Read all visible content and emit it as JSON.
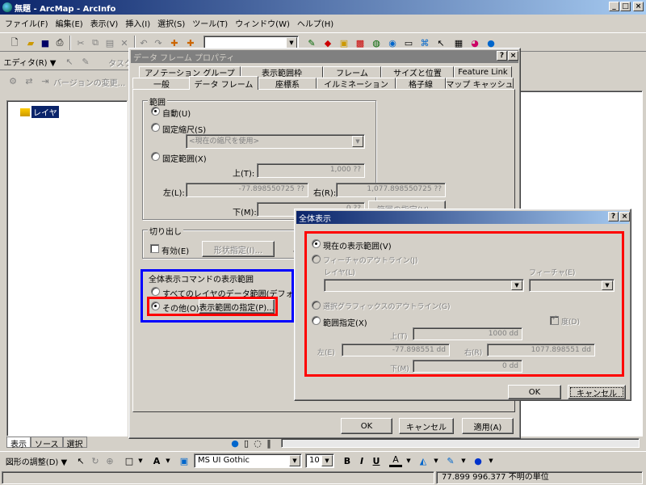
{
  "app": {
    "title": "無題 - ArcMap - ArcInfo"
  },
  "menu": [
    "ファイル(F)",
    "編集(E)",
    "表示(V)",
    "挿入(I)",
    "選択(S)",
    "ツール(T)",
    "ウィンドウ(W)",
    "ヘルプ(H)"
  ],
  "editor": {
    "label": "エディタ(R) ▼",
    "task_hint": "タスク",
    "version_label": "バージョンの変更..."
  },
  "toc": {
    "layer_label": "レイヤ",
    "tabs": [
      "表示",
      "ソース",
      "選択"
    ]
  },
  "draw": {
    "label": "図形の調整(D) ▼",
    "font": "MS UI Gothic",
    "size": "10",
    "bold": "B",
    "italic": "I",
    "underline": "U"
  },
  "status": {
    "coords": "77.899  996.377 不明の単位"
  },
  "props": {
    "title": "データ フレーム プロパティ",
    "tabs_back": [
      "アノテーション グループ",
      "表示範囲枠",
      "フレーム",
      "サイズと位置",
      "Feature Link"
    ],
    "tabs_front": [
      "一般",
      "データ フレーム",
      "座標系",
      "イルミネーション",
      "格子線",
      "マップ キャッシュ"
    ],
    "extent": {
      "group": "範囲",
      "auto": "自動(U)",
      "fixed_scale": "固定縮尺(S)",
      "scale_placeholder": "<現在の縮尺を使用>",
      "fixed_extent": "固定範囲(X)",
      "top_label": "上(T):",
      "top_value": "1,000 ??",
      "left_label": "左(L):",
      "left_value": "-77.898550725 ??",
      "right_label": "右(R):",
      "right_value": "1,077.898550725 ??",
      "bottom_label": "下(M):",
      "bottom_value": "0 ??",
      "specify_btn": "範囲の指定(V)..."
    },
    "clip": {
      "group": "切り出し",
      "enable": "有効(E)",
      "shape_btn": "形状指定(I)...",
      "extra": "ゃ"
    },
    "fullext": {
      "group": "全体表示コマンドの表示範囲",
      "all_layers": "すべてのレイヤのデータ範囲(デフォルト)(D)",
      "other": "その他(O):",
      "specify_btn": "表示範囲の指定(P)..."
    },
    "ok": "OK",
    "cancel": "キャンセル",
    "apply": "適用(A)"
  },
  "full": {
    "title": "全体表示",
    "current": "現在の表示範囲(V)",
    "outline": "フィーチャのアウトライン(J)",
    "layer_label": "レイヤ(L)",
    "feature_label": "フィーチャ(E)",
    "graphics": "選択グラフィックスのアウトライン(G)",
    "specify": "範囲指定(X)",
    "degree": "度(D)",
    "top_label": "上(T)",
    "top_value": "1000 dd",
    "left_label": "左(E)",
    "left_value": "-77.898551 dd",
    "right_label": "右(R)",
    "right_value": "1077.898551 dd",
    "bottom_label": "下(M)",
    "bottom_value": "0 dd",
    "ok": "OK",
    "cancel": "キャンセル"
  },
  "colors": {
    "title_active": "#0a246a",
    "title_inactive": "#808080",
    "highlight_red": "#ff0000",
    "highlight_blue": "#0000ff"
  }
}
